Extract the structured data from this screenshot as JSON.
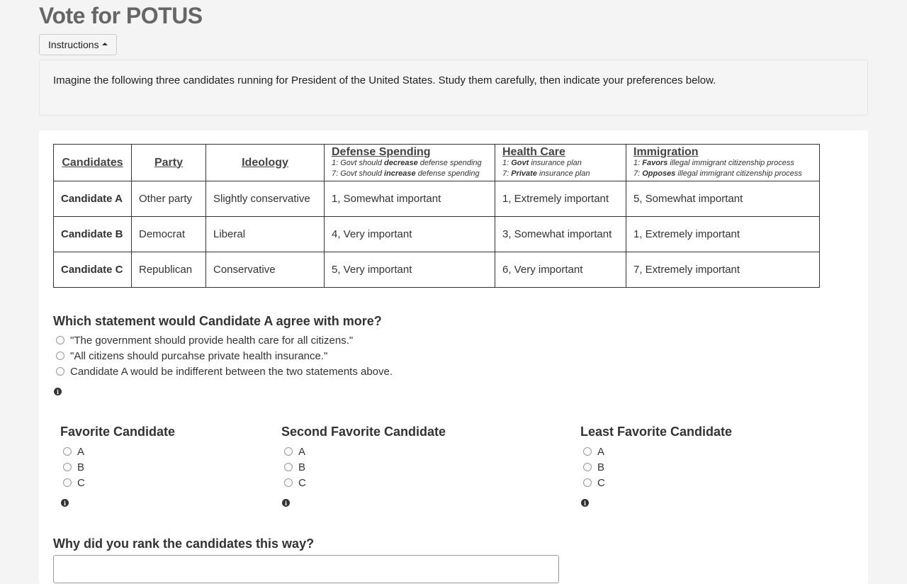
{
  "header": {
    "title": "Vote for POTUS",
    "instructions_button": "Instructions"
  },
  "instructions": {
    "text": "Imagine the following three candidates running for President of the United States. Study them carefully, then indicate your preferences below."
  },
  "table": {
    "headers": {
      "candidates": "Candidates",
      "party": "Party",
      "ideology": "Ideology",
      "defense": {
        "title": "Defense Spending",
        "scale1_pre": "1: Govt should ",
        "scale1_em": "decrease",
        "scale1_post": " defense spending",
        "scale7_pre": "7: Govt should ",
        "scale7_em": "increase",
        "scale7_post": " defense spending"
      },
      "health": {
        "title": "Health Care",
        "scale1_pre": "1: ",
        "scale1_em": "Govt",
        "scale1_post": " insurance plan",
        "scale7_pre": "7: ",
        "scale7_em": "Private",
        "scale7_post": " insurance plan"
      },
      "immigration": {
        "title": "Immigration",
        "scale1_pre": "1: ",
        "scale1_em": "Favors",
        "scale1_post": " illegal immigrant citizenship process",
        "scale7_pre": "7: ",
        "scale7_em": "Opposes",
        "scale7_post": " illegal immigrant citizenship process"
      }
    },
    "rows": [
      {
        "name": "Candidate A",
        "party": "Other party",
        "ideology": "Slightly conservative",
        "defense": "1, Somewhat important",
        "health": "1, Extremely important",
        "immigration": "5, Somewhat important"
      },
      {
        "name": "Candidate B",
        "party": "Democrat",
        "ideology": "Liberal",
        "defense": "4, Very important",
        "health": "3, Somewhat important",
        "immigration": "1, Extremely important"
      },
      {
        "name": "Candidate C",
        "party": "Republican",
        "ideology": "Conservative",
        "defense": "5, Very important",
        "health": "6, Very important",
        "immigration": "7, Extremely important"
      }
    ]
  },
  "question": {
    "title": "Which statement would Candidate A agree with more?",
    "options": [
      "\"The government should provide health care for all citizens.\"",
      "\"All citizens should purcahse private health insurance.\"",
      "Candidate A would be indifferent between the two statements above."
    ],
    "info_icon": "info-icon"
  },
  "ranking": {
    "favorite": {
      "title": "Favorite Candidate",
      "options": [
        "A",
        "B",
        "C"
      ]
    },
    "second": {
      "title": "Second Favorite Candidate",
      "options": [
        "A",
        "B",
        "C"
      ]
    },
    "least": {
      "title": "Least Favorite Candidate",
      "options": [
        "A",
        "B",
        "C"
      ]
    }
  },
  "why": {
    "title": "Why did you rank the candidates this way?"
  },
  "colors": {
    "background": "#f4f4f4",
    "card": "#ffffff",
    "text": "#333333",
    "title": "#666666"
  }
}
